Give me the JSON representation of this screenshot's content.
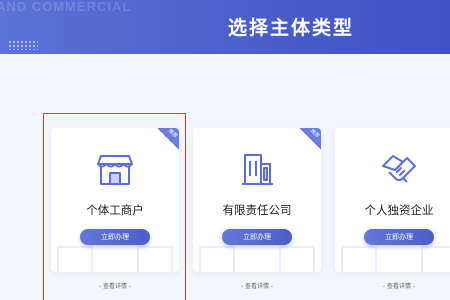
{
  "header": {
    "bg_text": "AND COMMERCIAL",
    "title": "选择主体类型"
  },
  "cards": [
    {
      "name": "个体工商户",
      "button": "立即办理",
      "detail": "- 查看详情 -",
      "icon": "shop-icon",
      "corner": "推荐"
    },
    {
      "name": "有限责任公司",
      "button": "立即办理",
      "detail": "- 查看详情 -",
      "icon": "building-icon",
      "corner": "推荐"
    },
    {
      "name": "个人独资企业",
      "button": "立即办理",
      "detail": "- 查看详情 -",
      "icon": "handshake-icon"
    }
  ],
  "colors": {
    "header": "#4a5fcb",
    "button": "#5468d0",
    "icon": "#5b6fd3",
    "highlight": "#e53935"
  }
}
